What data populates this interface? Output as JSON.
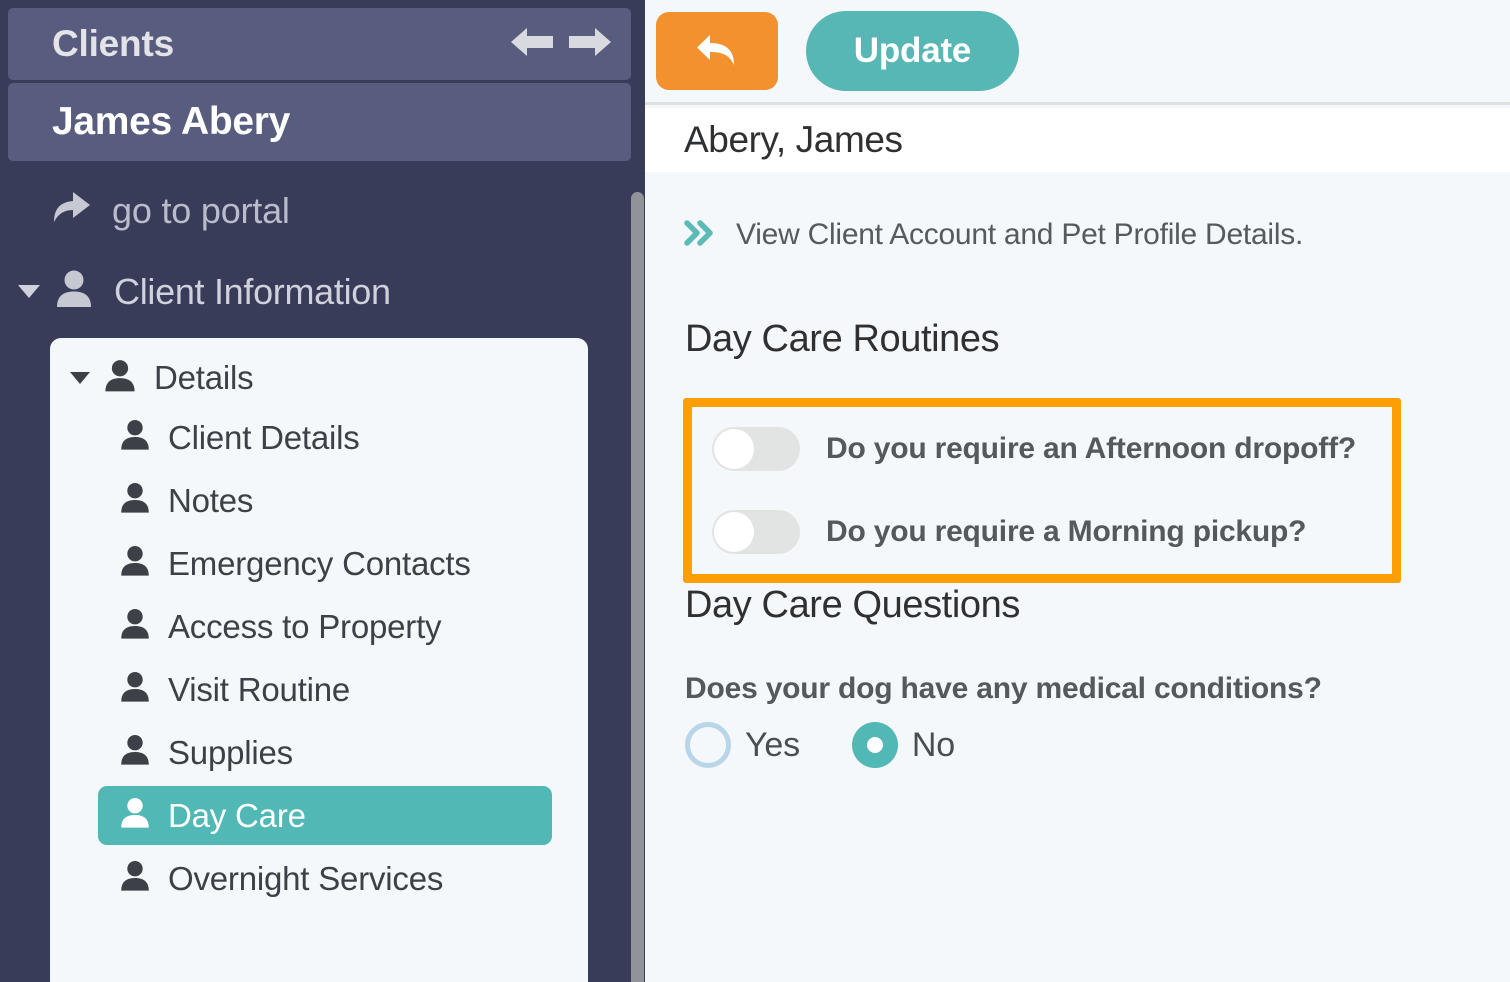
{
  "sidebar": {
    "header_title": "Clients",
    "nav_prev_icon": "arrow-left-icon",
    "nav_next_icon": "arrow-right-icon",
    "client_name": "James Abery",
    "portal_link": "go to portal",
    "portal_icon": "share-arrow-icon",
    "client_information_label": "Client Information",
    "client_information_icon": "person-icon",
    "submenu": {
      "group_label": "Details",
      "group_icon": "person-icon",
      "items": [
        {
          "label": "Client Details",
          "icon": "person-icon",
          "active": false
        },
        {
          "label": "Notes",
          "icon": "person-icon",
          "active": false
        },
        {
          "label": "Emergency Contacts",
          "icon": "person-icon",
          "active": false
        },
        {
          "label": "Access to Property",
          "icon": "person-icon",
          "active": false
        },
        {
          "label": "Visit Routine",
          "icon": "person-icon",
          "active": false
        },
        {
          "label": "Supplies",
          "icon": "person-icon",
          "active": false
        },
        {
          "label": "Day Care",
          "icon": "person-icon",
          "active": true
        },
        {
          "label": "Overnight Services",
          "icon": "person-icon",
          "active": false
        }
      ]
    }
  },
  "toolbar": {
    "back_icon": "back-arrow-icon",
    "update_label": "Update"
  },
  "header": {
    "client_title": "Abery, James"
  },
  "main": {
    "view_link_icon": "double-chevron-right-icon",
    "view_link_text": "View Client Account and Pet Profile Details.",
    "routines": {
      "heading": "Day Care Routines",
      "highlighted": true,
      "toggles": [
        {
          "label": "Do you require an Afternoon dropoff?",
          "value": "off"
        },
        {
          "label": "Do you require a Morning pickup?",
          "value": "off"
        }
      ]
    },
    "questions": {
      "heading": "Day Care Questions",
      "question": "Does your dog have any medical conditions?",
      "options": [
        {
          "label": "Yes",
          "selected": false
        },
        {
          "label": "No",
          "selected": true
        }
      ]
    }
  },
  "colors": {
    "sidebar_bg": "#383c59",
    "sidebar_header_bg": "#585d80",
    "accent_teal": "#51b8b5",
    "accent_orange": "#f2912e",
    "highlight_orange": "#fd9f02",
    "content_bg": "#f4f8fa"
  }
}
